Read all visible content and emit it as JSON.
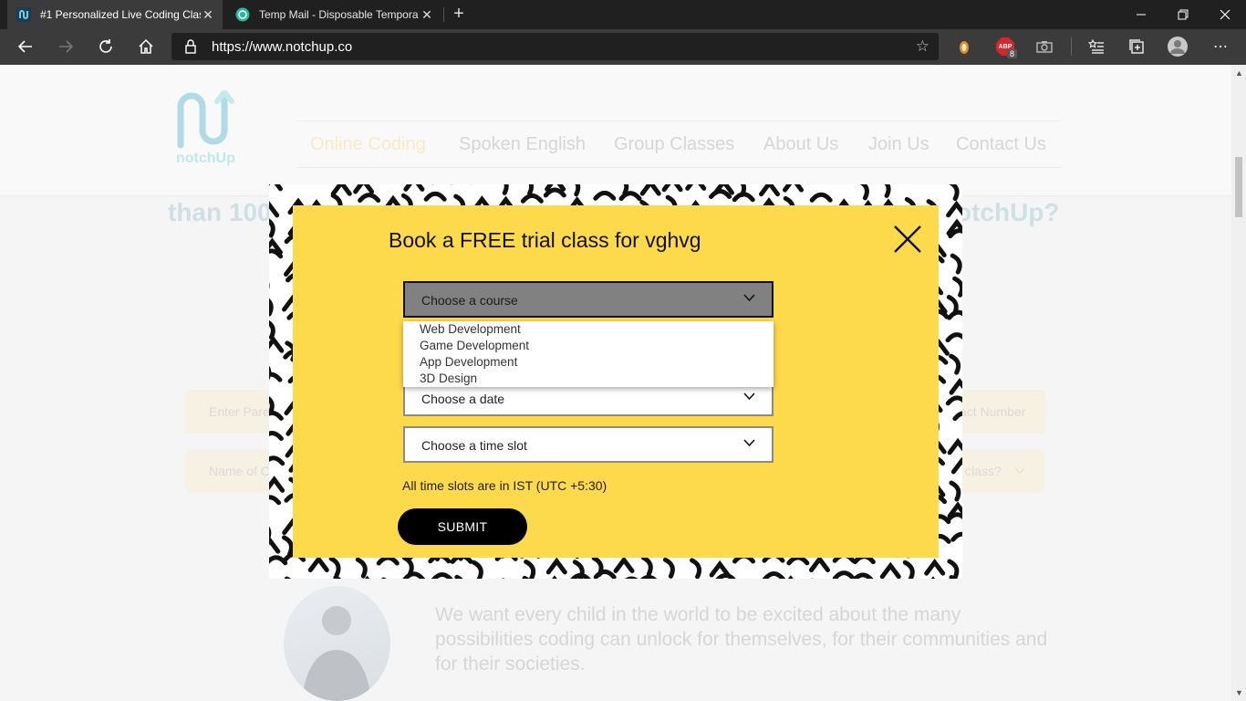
{
  "browser": {
    "tabs": [
      {
        "title": "#1 Personalized Live Coding Clas",
        "close": "✕"
      },
      {
        "title": "Temp Mail - Disposable Tempora",
        "close": "✕"
      }
    ],
    "new_tab": "+",
    "window_controls": {
      "minimize": "—",
      "restore": "❐",
      "close": "✕"
    },
    "url": "https://www.notchup.co",
    "extension_badge": "8",
    "extension_label": "ABP"
  },
  "site": {
    "logo_text": "notchUp",
    "nav": [
      "Online Coding",
      "Spoken English",
      "Group Classes",
      "About Us",
      "Join Us",
      "Contact Us"
    ],
    "heading_left": "than 100",
    "heading_right": "otchUp?",
    "form_bg": {
      "parent_placeholder": "Enter Pare",
      "contact_placeholder": "act Number",
      "child_placeholder": "Name of C",
      "class_placeholder": "class?"
    },
    "mission_text": "We want every child in the world to be excited about the many possibilities coding can unlock for themselves, for their communities and for their societies."
  },
  "modal": {
    "title": "Book a FREE trial class for vghvg",
    "course_select": "Choose a course",
    "course_options": [
      "Web Development",
      "Game Development",
      "App Development",
      "3D Design"
    ],
    "date_select": "Choose a date",
    "time_select": "Choose a time slot",
    "timezone_note": "All time slots are in IST (UTC +5:30)",
    "submit_label": "SUBMIT"
  },
  "colors": {
    "modal_yellow": "#fdd94c",
    "submit_bg": "#000000",
    "nav_active": "#f6e3b4",
    "logo_teal": "#6dd2d2"
  }
}
